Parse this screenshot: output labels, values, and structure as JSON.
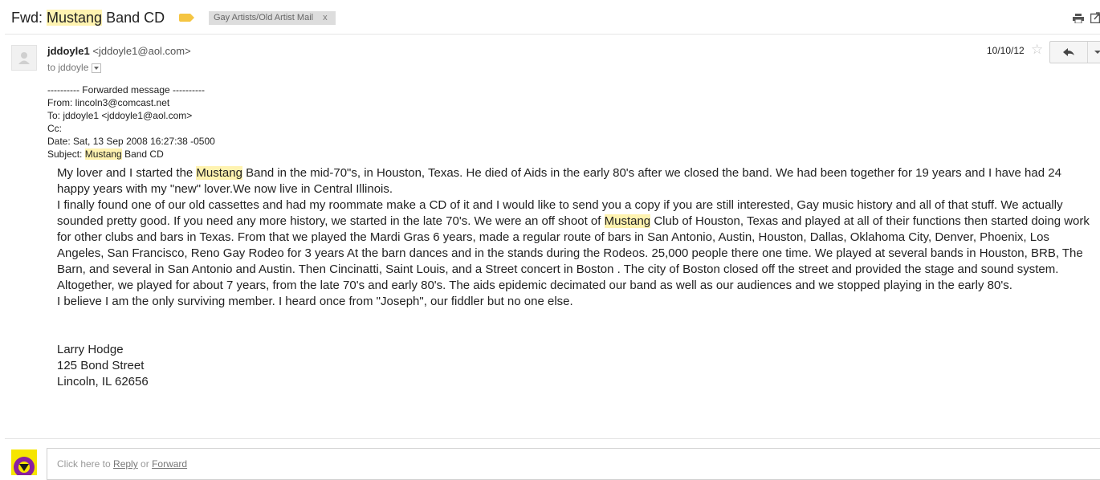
{
  "subject": {
    "prefix": "Fwd: ",
    "highlight": "Mustang",
    "suffix": " Band CD",
    "label_chip": "Gay Artists/Old Artist Mail",
    "label_remove": "x"
  },
  "sender": {
    "name": "jddoyle1",
    "email": "<jddoyle1@aol.com>",
    "recipient_line": "to jddoyle",
    "date": "10/10/12",
    "star_glyph": "☆"
  },
  "forwarded": {
    "divider": "---------- Forwarded message ----------",
    "from": "From: lincoln3@comcast.net",
    "to": "To: jddoyle1 <jddoyle1@aol.com>",
    "cc": "Cc:",
    "date": "Date: Sat, 13 Sep 2008 16:27:38 -0500",
    "subject_prefix": "Subject: ",
    "subject_highlight": "Mustang",
    "subject_suffix": " Band CD"
  },
  "body": {
    "p1_a": "My lover and I started the ",
    "p1_hl": "Mustang",
    "p1_b": " Band in the mid-70\"s, in Houston, Texas.  He died of Aids in the early 80's after we closed the band.  We had been together for 19 years and I have had 24 happy years with my \"new\" lover.We now live in Central Illinois.",
    "p2_a": "I finally found one of our old cassettes and had my roommate make a CD of it and I would like to send you a copy if you are still interested, Gay music history and all of that stuff.  We actually sounded pretty good.  If you need any more history, we started in the late 70's.   We were an off shoot of ",
    "p2_hl": "Mustang",
    "p2_b": " Club of Houston, Texas and played at all of their functions then started doing work for other clubs and bars in Texas.  From that we played the Mardi Gras 6 years, made a regular route of bars in San Antonio, Austin, Houston, Dallas, Oklahoma City, Denver, Phoenix, Los Angeles, San Francisco, Reno Gay Rodeo for 3 years At the barn dances and in the stands during the Rodeos.  25,000 people there one time. We played at several bands in Houston, BRB, The Barn, and several in San Antonio and Austin.  Then Cincinatti, Saint Louis, and a Street concert in Boston .  The city of Boston closed off the street and provided the stage and sound system.  Altogether, we played for about 7 years, from the late 70's and early 80's.  The aids epidemic decimated our band as well as our audiences and we stopped playing in the early 80's.",
    "p3": "I believe I am the only surviving member.  I heard once from \"Joseph\", our fiddler but no one else."
  },
  "signature": {
    "name": "Larry Hodge",
    "street": "125 Bond Street",
    "city": "Lincoln, IL 62656"
  },
  "reply_bar": {
    "prefix": "Click here to ",
    "reply": "Reply",
    "or": " or ",
    "forward": "Forward"
  }
}
